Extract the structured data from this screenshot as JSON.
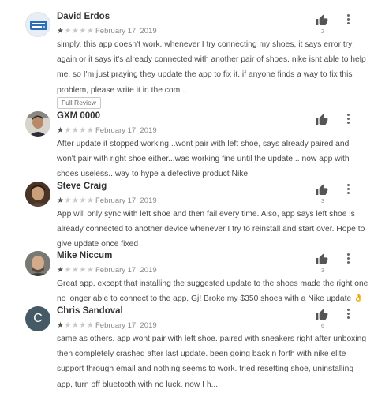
{
  "reviews": [
    {
      "author": "David Erdos",
      "rating": 1,
      "date": "February 17, 2019",
      "helpful_count": "2",
      "text": "simply, this app doesn't work. whenever I try connecting my shoes, it says error try again or it says it's already connected with another pair of shoes. nike isnt able to help me, so I'm just praying they update the app to fix it. if anyone finds a way to fix this problem, please write it in the com...",
      "full_review_label": "Full Review"
    },
    {
      "author": "GXM 0000",
      "rating": 1,
      "date": "February 17, 2019",
      "helpful_count": "",
      "text": "After update it stopped working...wont pair with left shoe, says already paired and won't pair with right shoe either...was working fine until the update... now app with shoes useless...way to hype a defective product Nike"
    },
    {
      "author": "Steve Craig",
      "rating": 1,
      "date": "February 17, 2019",
      "helpful_count": "3",
      "text": "App will only sync with left shoe and then fail every time. Also, app says left shoe is already connected to another device whenever I try to reinstall and start over. Hope to give update once fixed"
    },
    {
      "author": "Mike Niccum",
      "rating": 1,
      "date": "February 17, 2019",
      "helpful_count": "3",
      "text": "Great app, except that installing the suggested update to the shoes made the right one no longer able to connect to the app. Gj! Broke my $350 shoes with a Nike update 👌"
    },
    {
      "author": "Chris Sandoval",
      "avatar_letter": "C",
      "rating": 1,
      "date": "February 17, 2019",
      "helpful_count": "6",
      "text": "same as others. app wont pair with left shoe. paired with sneakers right after unboxing then completely crashed after last update. been going back n forth with nike elite support through email and nothing seems to work. tried resetting shoe, uninstalling app, turn off bluetooth with no luck. now I h..."
    }
  ],
  "icons": {
    "thumb": "thumbs-up-icon",
    "menu": "more-vert-icon",
    "star": "star-icon"
  },
  "colors": {
    "text": "#4a4a4a",
    "meta": "#8a8a8a",
    "avatar_c": "#455a64"
  }
}
